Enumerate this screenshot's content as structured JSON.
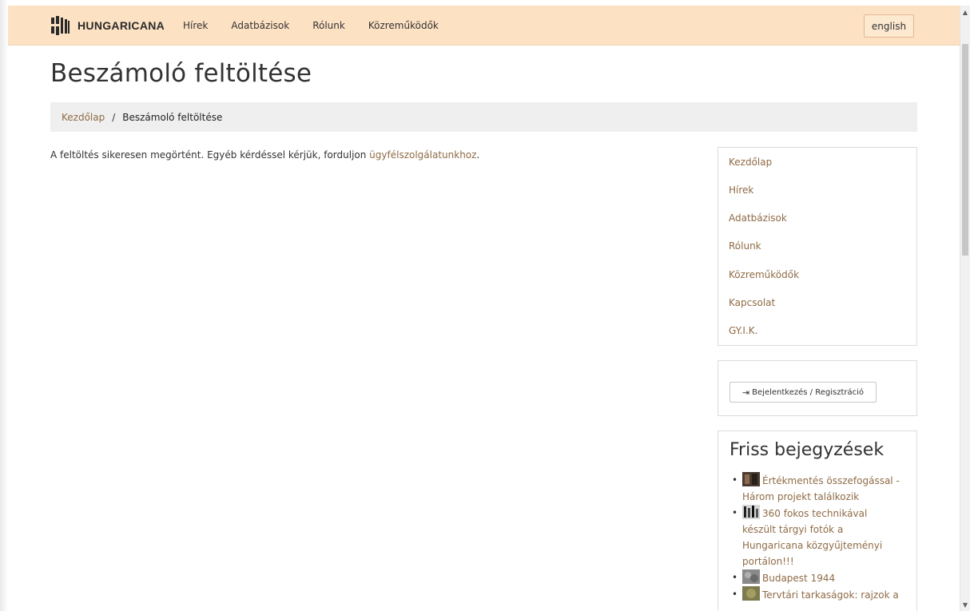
{
  "navbar": {
    "brand": "HUNGARICANA",
    "links": [
      "Hírek",
      "Adatbázisok",
      "Rólunk",
      "Közreműködők"
    ],
    "lang_button": "english",
    "background": "#fde1c3"
  },
  "page": {
    "title": "Beszámoló feltöltése"
  },
  "breadcrumb": {
    "home": "Kezdőlap",
    "separator": "/",
    "current": "Beszámoló feltöltése"
  },
  "message": {
    "text": "A feltöltés sikeresen megörtént. Egyéb kérdéssel kérjük, forduljon ",
    "link": "ügyfélszolgálatunkhoz",
    "end": "."
  },
  "sidebar": {
    "nav_items": [
      "Kezdőlap",
      "Hírek",
      "Adatbázisok",
      "Rólunk",
      "Közreműködők",
      "Kapcsolat",
      "GY.I.K."
    ],
    "login_label": "Bejelentkezés / Regisztráció",
    "login_icon": "sign-in-icon",
    "posts_title": "Friss bejegyzések",
    "posts": [
      {
        "lines": [
          "Értékmentés összefogással -",
          "Három projekt találkozik"
        ],
        "thumb": "photo-thumb-dark"
      },
      {
        "lines": [
          "360 fokos technikával",
          "készült tárgyi fotók a",
          "Hungaricana közgyűjteményi",
          "portálon!!!"
        ],
        "thumb": "photo-thumb-bw"
      },
      {
        "lines": [
          "Budapest 1944"
        ],
        "thumb": "photo-thumb-grey"
      },
      {
        "lines": [
          "Tervtári tarkaságok: rajzok a"
        ],
        "thumb": "photo-thumb-olive"
      }
    ]
  },
  "colors": {
    "link": "#8f6b45",
    "breadcrumb_bg": "#efefef"
  }
}
